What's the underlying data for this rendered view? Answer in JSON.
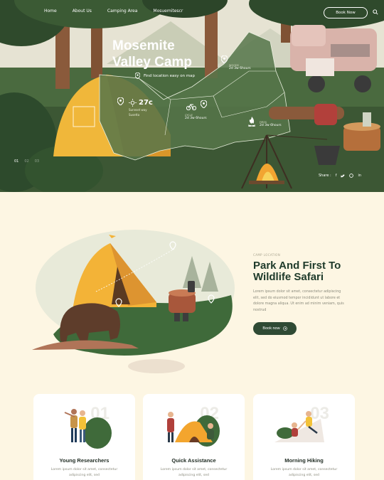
{
  "nav": {
    "items": [
      "Home",
      "About Us",
      "Camping Area",
      "Mosuemitescr"
    ],
    "book_now": "Book Now"
  },
  "hero": {
    "title_line1": "Mosemite",
    "title_line2": "Valley Camp",
    "find_location": "Find location easy on map",
    "weather": {
      "temp": "27c",
      "line1": "Sunnset way",
      "line2": "Susetta"
    },
    "region_a": {
      "label": "WOODS",
      "value": "2d 3w 6hours"
    },
    "region_b": {
      "label": "CYCLE",
      "value": "2d 3w 6hours"
    },
    "region_c": {
      "label": "FIRES",
      "value": "2d 3w 6hours"
    },
    "slides": {
      "current": "01",
      "second": "02",
      "third": "03"
    },
    "share_label": "Share :"
  },
  "about": {
    "eyebrow": "CAMP LOCATION",
    "title": "Park And First To Wildlife Safari",
    "body": "Lorem ipsum dolor sit amet, consectetur adipiscing elit, sed do eiusmod tempor incididunt ut labore et dolore magna aliqua. Ut enim ad minim veniam, quis nostrud",
    "button": "Book now"
  },
  "cards": [
    {
      "num": "01",
      "title": "Young Researchers",
      "body": "Lorem ipsum dolor sit amet, consectetur adipiscing elit, sed"
    },
    {
      "num": "02",
      "title": "Quick Assistance",
      "body": "Lorem ipsum dolor sit amet, consectetur adipiscing elit, sed"
    },
    {
      "num": "03",
      "title": "Morning Hiking",
      "body": "Lorem ipsum dolor sit amet, consectetur adipiscing elit, sed"
    }
  ],
  "colors": {
    "dark_green": "#2f4a34",
    "cream": "#fdf6e3",
    "tent_yellow": "#f2b632",
    "hero_green": "#3e5c37"
  }
}
